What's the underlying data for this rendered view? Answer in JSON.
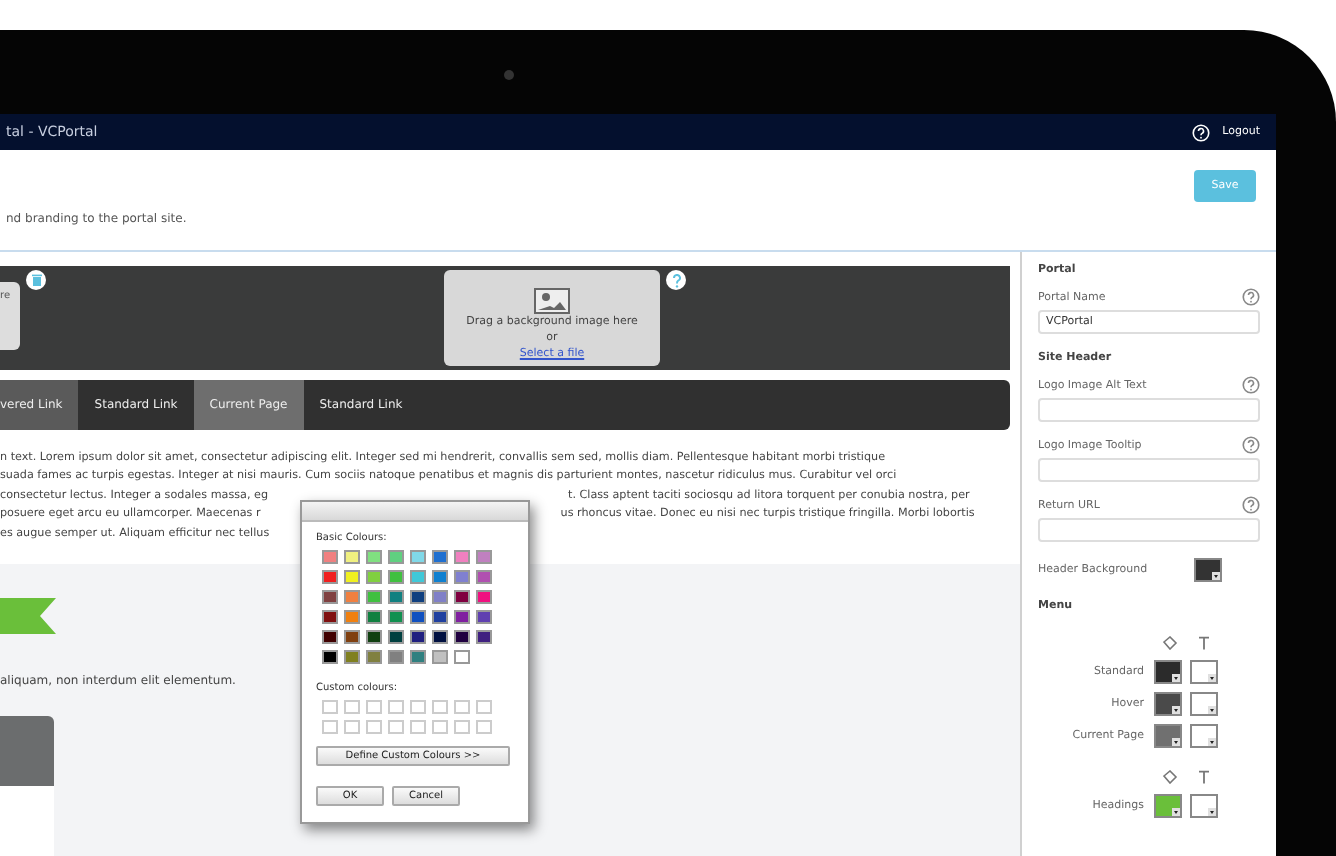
{
  "header": {
    "title": "tal - VCPortal",
    "logout": "Logout"
  },
  "toolbar": {
    "save": "Save",
    "description": "nd branding to the portal site."
  },
  "banner": {
    "logo_text": "re",
    "dropzone": {
      "text": "Drag a background image here",
      "or": "or",
      "link": "Select a file"
    }
  },
  "menu": [
    {
      "label": "vered Link",
      "kind": "hover"
    },
    {
      "label": "Standard Link",
      "kind": "standard"
    },
    {
      "label": "Current Page",
      "kind": "current"
    },
    {
      "label": "Standard Link",
      "kind": "standard"
    }
  ],
  "body_lines": [
    {
      "left": "n text. Lorem ipsum dolor sit amet, consectetur adipiscing elit. Integer sed mi hendrerit, convallis sem sed, mollis diam. Pellentesque habitant morbi tristique"
    },
    {
      "left": "suada fames ac turpis egestas. Integer at nisi mauris. Cum sociis natoque penatibus et magnis dis parturient montes, nascetur ridiculus mus. Curabitur vel orci"
    },
    {
      "left": "consectetur lectus. Integer a sodales massa, eg",
      "right": "t. Class aptent taciti sociosqu ad litora torquent per conubia nostra, per"
    },
    {
      "left": "posuere eget arcu eu ullamcorper. Maecenas r",
      "right": "us rhoncus vitae. Donec eu nisi nec turpis tristique fringilla. Morbi lobortis"
    },
    {
      "left": "es augue semper ut. Aliquam efficitur nec tellus"
    }
  ],
  "caption": "aliquam, non interdum elit elementum.",
  "color_dialog": {
    "basic_label": "Basic Colours:",
    "custom_label": "Custom colours:",
    "define": "Define Custom Colours >>",
    "ok": "OK",
    "cancel": "Cancel",
    "swatches": [
      {
        "color": "#f08080"
      },
      {
        "color": "#f0f080"
      },
      {
        "color": "#80e080"
      },
      {
        "color": "#60d080"
      },
      {
        "color": "#80d8e8"
      },
      {
        "color": "#2070d0"
      },
      {
        "color": "#f080c0"
      },
      {
        "color": "#c080c0"
      },
      {
        "color": "#f02020"
      },
      {
        "color": "#f0f020"
      },
      {
        "color": "#80d040"
      },
      {
        "color": "#40c040"
      },
      {
        "color": "#40c8d8"
      },
      {
        "color": "#1080d0"
      },
      {
        "color": "#8080d0"
      },
      {
        "color": "#b050b0"
      },
      {
        "color": "#804040"
      },
      {
        "color": "#f08040"
      },
      {
        "color": "#40c040"
      },
      {
        "color": "#108080"
      },
      {
        "color": "#104080"
      },
      {
        "color": "#8080c8"
      },
      {
        "color": "#800040"
      },
      {
        "color": "#f01080"
      },
      {
        "color": "#801010"
      },
      {
        "color": "#f08010"
      },
      {
        "color": "#108040"
      },
      {
        "color": "#109050"
      },
      {
        "color": "#1050c0"
      },
      {
        "color": "#2040a0"
      },
      {
        "color": "#8020a0"
      },
      {
        "color": "#6040b0"
      },
      {
        "color": "#400000"
      },
      {
        "color": "#804010"
      },
      {
        "color": "#104010"
      },
      {
        "color": "#004040"
      },
      {
        "color": "#202080"
      },
      {
        "color": "#001040"
      },
      {
        "color": "#200040"
      },
      {
        "color": "#402080"
      },
      {
        "color": "#000000"
      },
      {
        "color": "#808020"
      },
      {
        "color": "#808040"
      },
      {
        "color": "#808080"
      },
      {
        "color": "#308080"
      },
      {
        "color": "#c0c0c0"
      },
      {
        "color": "#ffffff"
      }
    ]
  },
  "panel": [
    {
      "kind": "heading",
      "label": "Portal"
    },
    {
      "kind": "field",
      "label": "Portal Name",
      "value": "VCPortal"
    },
    {
      "kind": "heading",
      "label": "Site Header"
    },
    {
      "kind": "field",
      "label": "Logo Image Alt Text"
    },
    {
      "kind": "field",
      "label": "Logo Image Tooltip"
    },
    {
      "kind": "field",
      "label": "Return URL"
    },
    {
      "kind": "swatch",
      "label": "Header Background",
      "color": "#333333"
    },
    {
      "kind": "heading",
      "label": "Menu"
    },
    {
      "kind": "icons"
    },
    {
      "kind": "pair",
      "label": "Standard",
      "colors": [
        {
          "color": "#2b2b2b"
        },
        {
          "color": "#ffffff"
        }
      ]
    },
    {
      "kind": "pair",
      "label": "Hover",
      "colors": [
        {
          "color": "#4a4a4a"
        },
        {
          "color": "#ffffff"
        }
      ]
    },
    {
      "kind": "pair",
      "label": "Current Page",
      "colors": [
        {
          "color": "#707070"
        },
        {
          "color": "#ffffff"
        }
      ]
    },
    {
      "kind": "icons"
    },
    {
      "kind": "pair",
      "label": "Headings",
      "colors": [
        {
          "color": "#6abf3a"
        },
        {
          "color": "#ffffff"
        }
      ]
    }
  ]
}
